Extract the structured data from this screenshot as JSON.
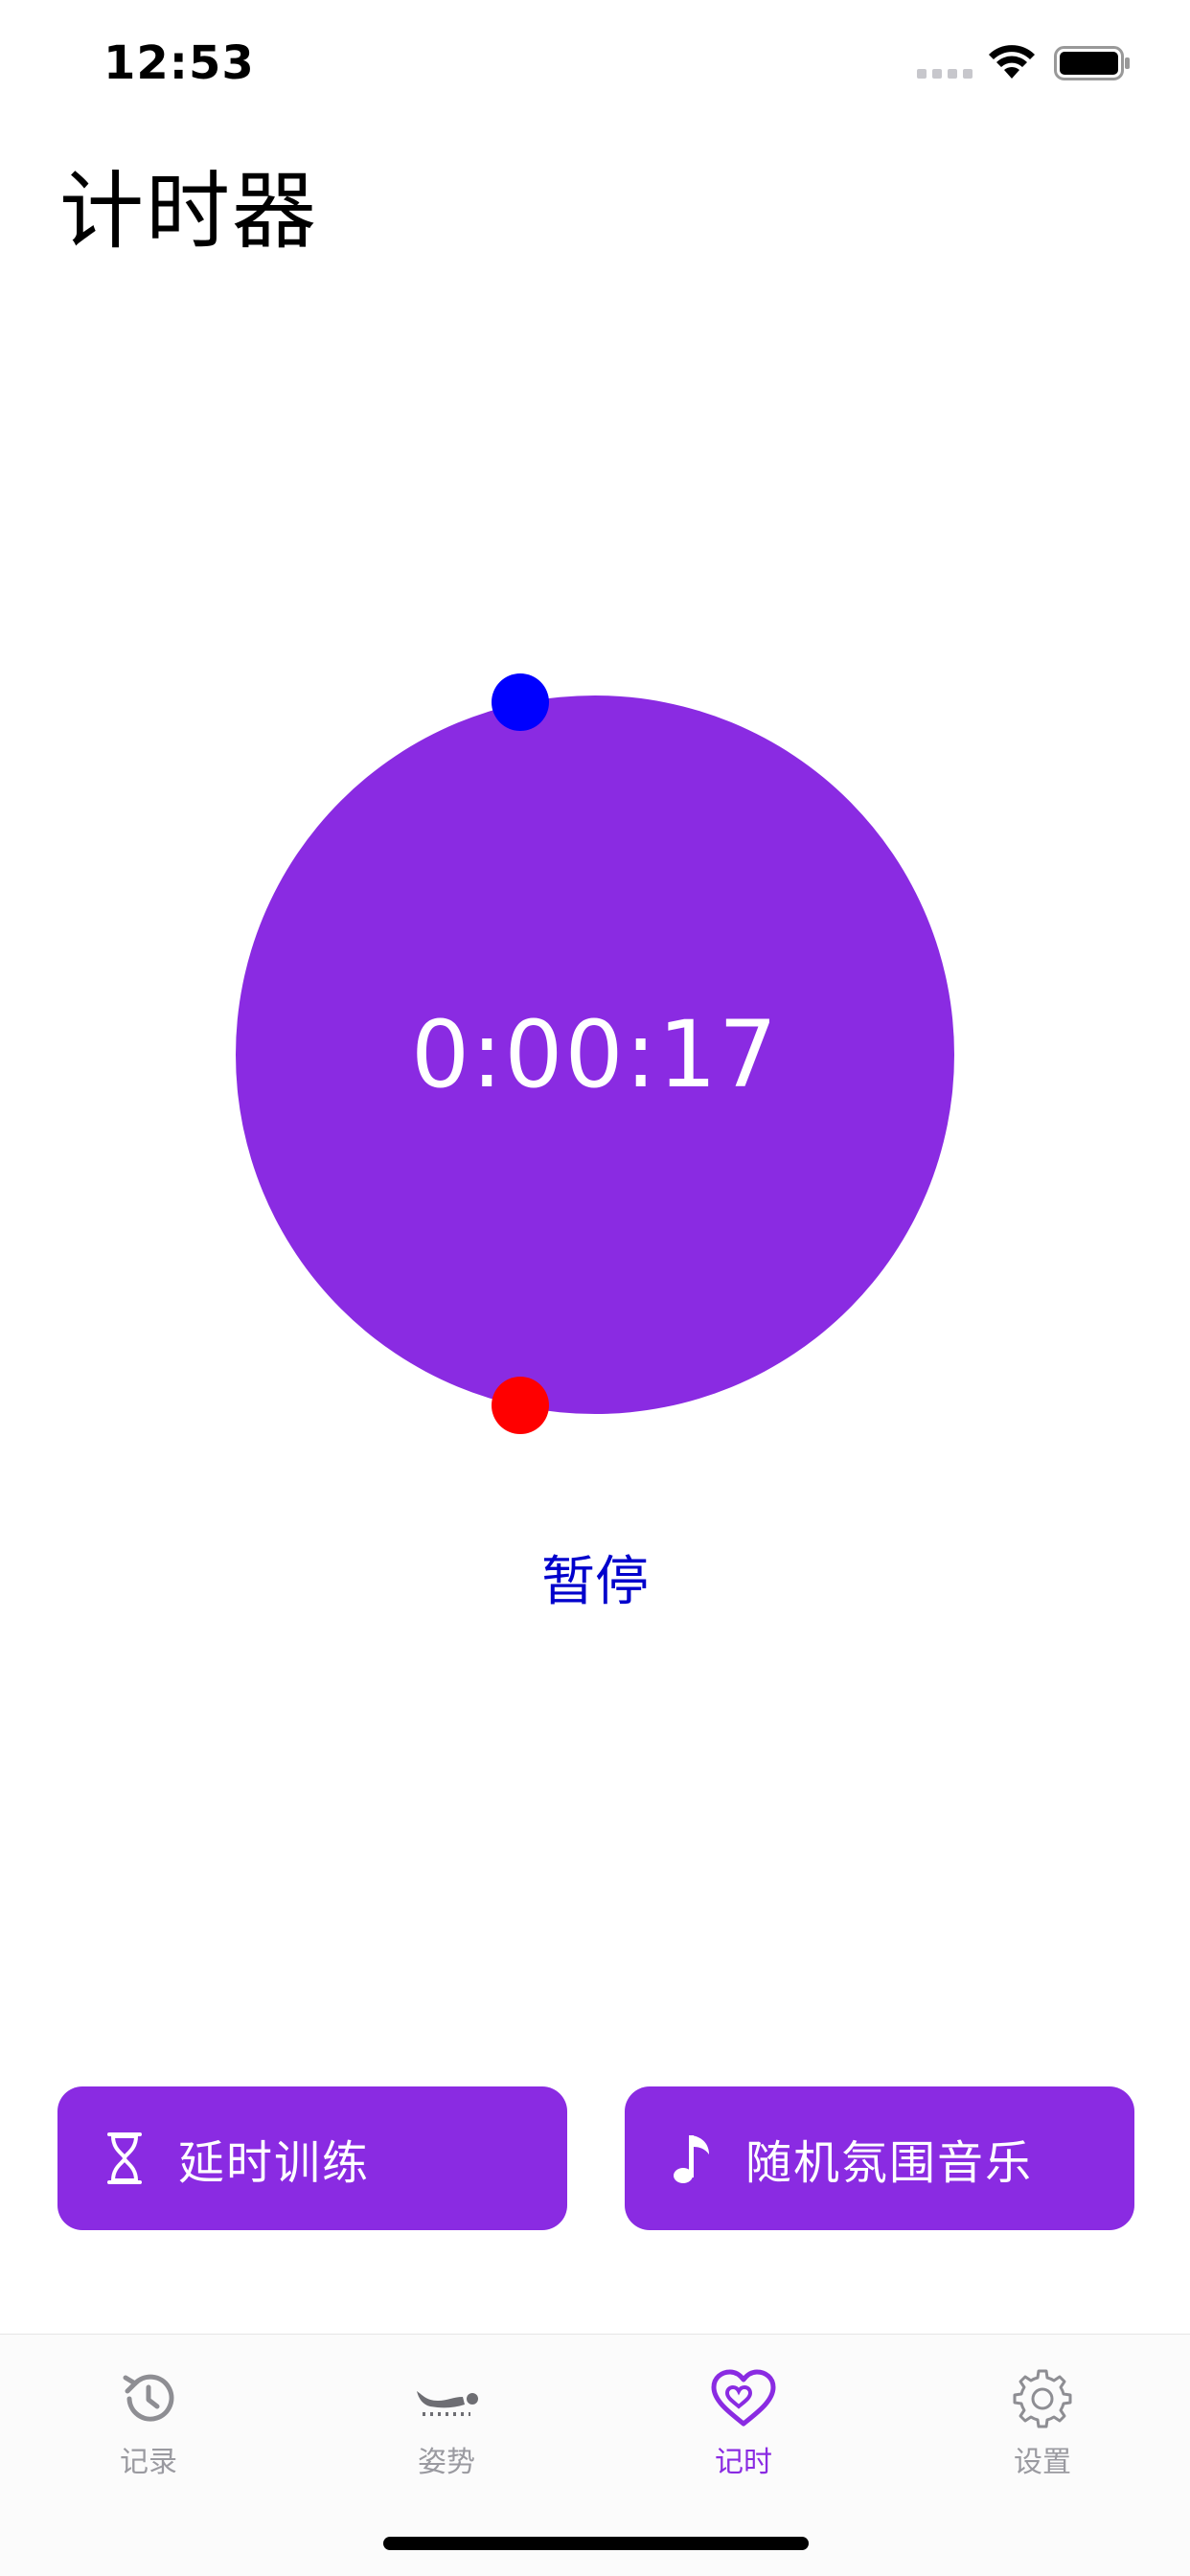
{
  "status_bar": {
    "time": "12:53",
    "wifi_icon": "wifi-icon",
    "battery_icon": "battery-icon",
    "signal_icon": "signal-dots-icon"
  },
  "page": {
    "title": "计时器"
  },
  "timer": {
    "elapsed": "0:00:17",
    "circle_color": "#8A2BE2",
    "start_knob_color": "#0000FF",
    "end_knob_color": "#FF0000"
  },
  "controls": {
    "pause_label": "暂停",
    "pause_color": "#0000CC"
  },
  "actions": [
    {
      "label": "延时训练",
      "icon": "hourglass-icon"
    },
    {
      "label": "随机氛围音乐",
      "icon": "music-note-icon"
    }
  ],
  "tabs": [
    {
      "label": "记录",
      "icon": "history-icon",
      "active": false
    },
    {
      "label": "姿势",
      "icon": "pose-icon",
      "active": false
    },
    {
      "label": "记时",
      "icon": "heart-icon",
      "active": true
    },
    {
      "label": "设置",
      "icon": "gear-icon",
      "active": false
    }
  ],
  "colors": {
    "accent": "#8A2BE2",
    "tab_inactive": "#9A9AA0"
  }
}
